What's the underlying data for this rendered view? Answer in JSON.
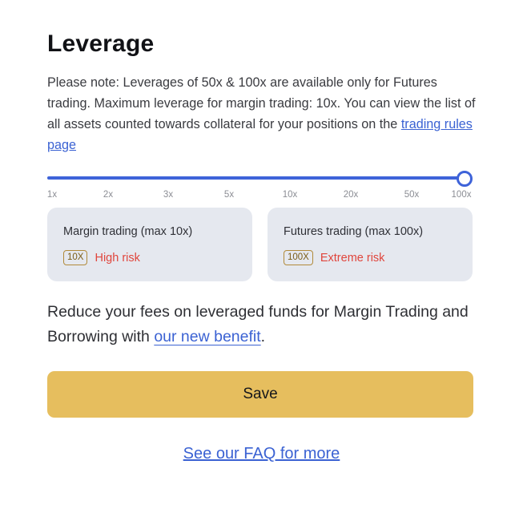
{
  "dialog": {
    "title": "Leverage",
    "note_text": "Please note: Leverages of 50x & 100x are available only for Futures trading. Maximum leverage for margin trading: 10x. You can view the list of all assets counted towards collateral for your positions on the ",
    "note_link": "trading rules page"
  },
  "slider": {
    "ticks": [
      "1x",
      "2x",
      "3x",
      "5x",
      "10x",
      "20x",
      "50x",
      "100x"
    ],
    "selected": "100x",
    "selected_index": 7,
    "accent_color": "#3e63d9"
  },
  "cards": {
    "margin": {
      "title": "Margin trading (max 10x)",
      "badge": "10X",
      "risk": "High risk"
    },
    "futures": {
      "title": "Futures trading (max 100x)",
      "badge": "100X",
      "risk": "Extreme risk"
    }
  },
  "promo": {
    "text": "Reduce your fees on leveraged funds for Margin Trading and Borrowing with ",
    "link": "our new benefit",
    "suffix": "."
  },
  "actions": {
    "save_label": "Save",
    "faq_link": "See our FAQ for more"
  },
  "colors": {
    "primary_button": "#e6be5e",
    "risk": "#e0453c",
    "link": "#3b62d3"
  }
}
